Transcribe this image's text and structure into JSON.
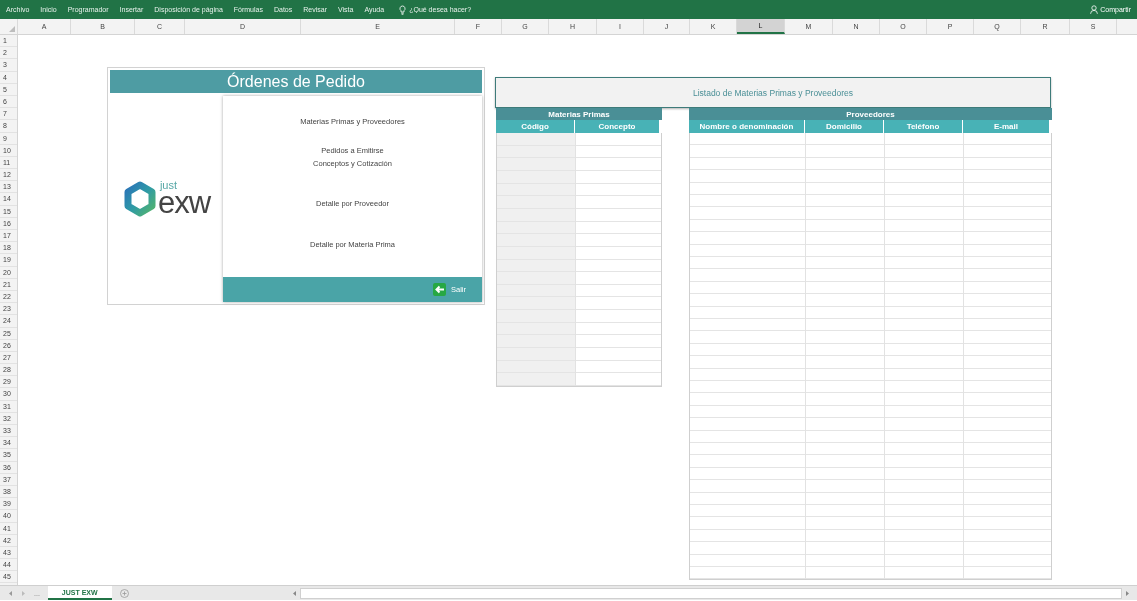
{
  "ribbon": {
    "tabs": [
      {
        "label": "Archivo"
      },
      {
        "label": "Inicio"
      },
      {
        "label": "Programador"
      },
      {
        "label": "Insertar"
      },
      {
        "label": "Disposición de página"
      },
      {
        "label": "Fórmulas"
      },
      {
        "label": "Datos"
      },
      {
        "label": "Revisar"
      },
      {
        "label": "Vista"
      },
      {
        "label": "Ayuda"
      }
    ],
    "tell_me": {
      "placeholder": "¿Qué desea hacer?"
    },
    "share_button": "Compartir"
  },
  "columns": [
    {
      "label": "A",
      "selected": false
    },
    {
      "label": "B",
      "selected": false
    },
    {
      "label": "C",
      "selected": false
    },
    {
      "label": "D",
      "selected": false
    },
    {
      "label": "E",
      "selected": false
    },
    {
      "label": "F",
      "selected": false
    },
    {
      "label": "G",
      "selected": false
    },
    {
      "label": "H",
      "selected": false
    },
    {
      "label": "I",
      "selected": false
    },
    {
      "label": "J",
      "selected": false
    },
    {
      "label": "K",
      "selected": false
    },
    {
      "label": "L",
      "selected": true
    },
    {
      "label": "M",
      "selected": false
    },
    {
      "label": "N",
      "selected": false
    },
    {
      "label": "O",
      "selected": false
    },
    {
      "label": "P",
      "selected": false
    },
    {
      "label": "Q",
      "selected": false
    },
    {
      "label": "R",
      "selected": false
    },
    {
      "label": "S",
      "selected": false
    }
  ],
  "rows": [
    "1",
    "2",
    "3",
    "4",
    "5",
    "6",
    "7",
    "8",
    "9",
    "10",
    "11",
    "12",
    "13",
    "14",
    "15",
    "16",
    "17",
    "18",
    "19",
    "20",
    "21",
    "22",
    "23",
    "24",
    "25",
    "26",
    "27",
    "28",
    "29",
    "30",
    "31",
    "32",
    "33",
    "34",
    "35",
    "36",
    "37",
    "38",
    "39",
    "40",
    "41",
    "42",
    "43",
    "44",
    "45"
  ],
  "menu_panel": {
    "title": "Órdenes de Pedido",
    "logo": {
      "small": "just",
      "large": "exw"
    },
    "items": [
      {
        "label": "Materias Primas y Proveedores"
      },
      {
        "label": "Pedidos a Emitirse\nConceptos y Cotización"
      },
      {
        "label": "Detalle por Proveedor"
      },
      {
        "label": "Detalle por Materia Prima"
      }
    ],
    "exit_button": "Salir"
  },
  "listing": {
    "title": "Listado de Materias Primas y Proveedores",
    "groups": [
      {
        "label": "Materias Primas",
        "columns": [
          "Código",
          "Concepto"
        ]
      },
      {
        "label": "Proveedores",
        "columns": [
          "Nombre o denominación",
          "Domicilio",
          "Teléfono",
          "E-mail"
        ]
      }
    ]
  },
  "sheet_tabs": {
    "more": "...",
    "tabs": [
      {
        "label": "JUST EXW",
        "selected": true
      }
    ]
  }
}
